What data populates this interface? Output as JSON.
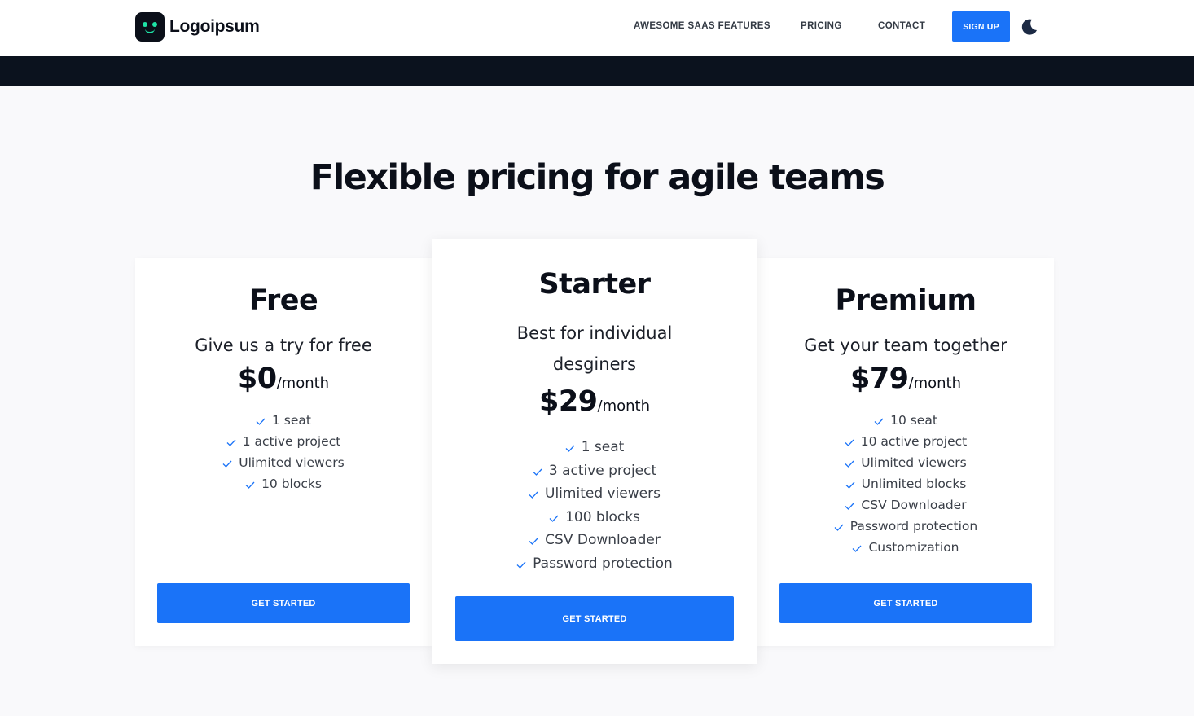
{
  "header": {
    "logo_text": "Logoipsum",
    "nav": [
      "AWESOME SAAS FEATURES",
      "PRICING",
      "CONTACT"
    ],
    "signup_label": "SIGN UP",
    "theme_icon": "moon-icon"
  },
  "main": {
    "title": "Flexible pricing for agile teams"
  },
  "plans": [
    {
      "name": "Free",
      "subtitle": "Give us a try for free",
      "price": "$0",
      "period": "/month",
      "features": [
        "1 seat",
        "1 active project",
        "Ulimited viewers",
        "10 blocks"
      ],
      "cta": "GET STARTED"
    },
    {
      "name": "Starter",
      "subtitle_line1": "Best for individual",
      "subtitle_line2": "desginers",
      "price": "$29",
      "period": "/month",
      "features": [
        "1 seat",
        "3 active project",
        "Ulimited viewers",
        "100 blocks",
        "CSV Downloader",
        "Password protection"
      ],
      "cta": "GET STARTED"
    },
    {
      "name": "Premium",
      "subtitle": "Get your team together",
      "price": "$79",
      "period": "/month",
      "features": [
        "10 seat",
        "10 active project",
        "Ulimited viewers",
        "Unlimited blocks",
        "CSV Downloader",
        "Password protection",
        "Customization"
      ],
      "cta": "GET STARTED"
    }
  ],
  "colors": {
    "accent": "#1a73f8",
    "dark": "#0b121e",
    "check": "#1a73f8",
    "logo_accent": "#1ee3a6"
  }
}
